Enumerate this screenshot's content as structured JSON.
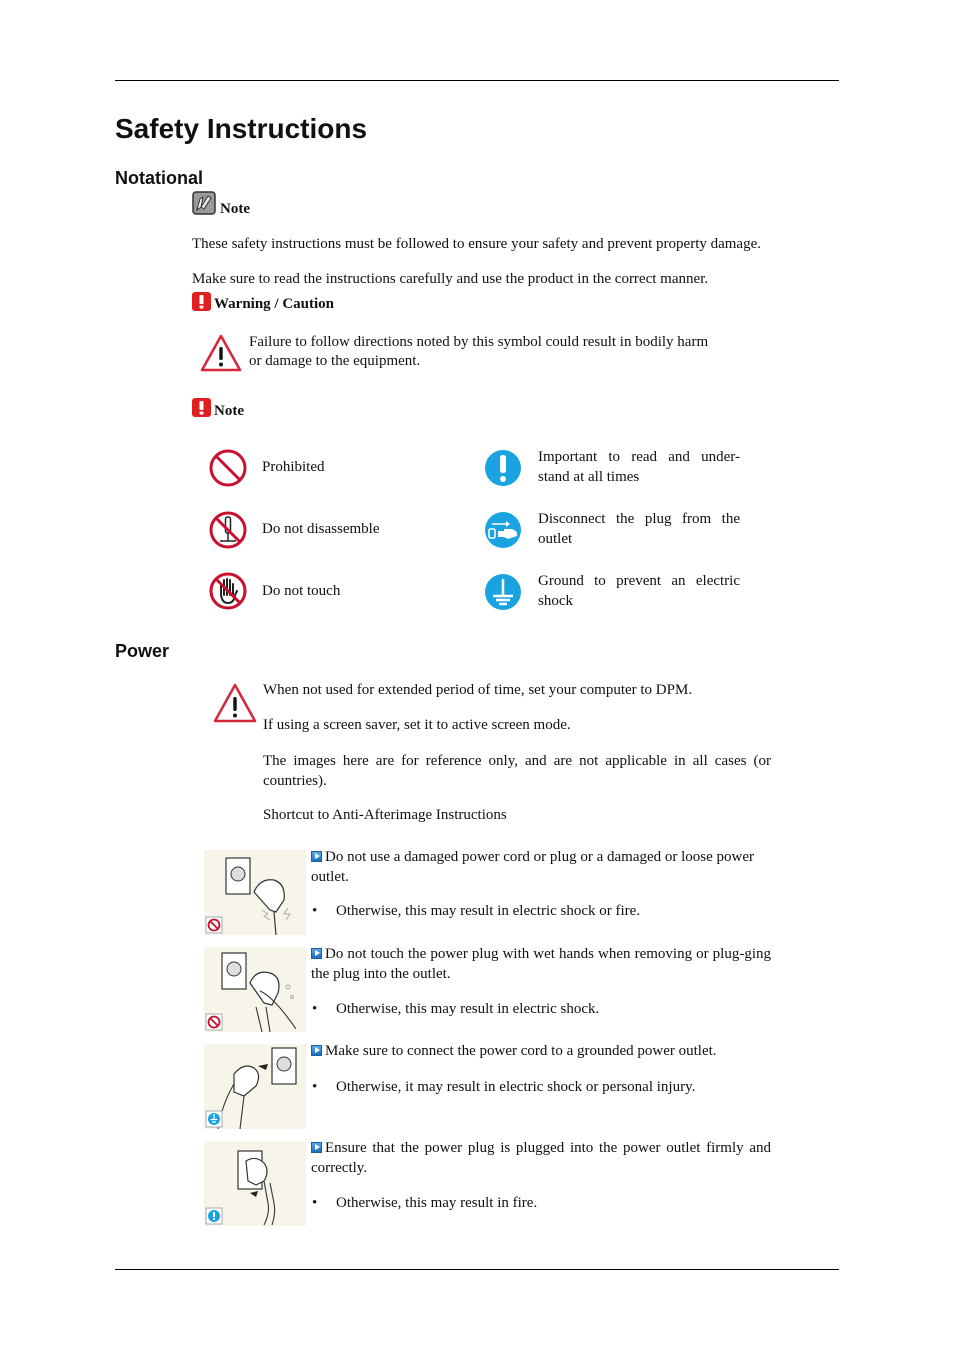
{
  "page_title": "Safety Instructions",
  "sections": {
    "notational": {
      "heading": "Notational",
      "note_label": "Note",
      "paragraphs": [
        "These safety instructions must be followed to ensure your safety and prevent property damage.",
        "Make sure to read the instructions carefully and use the product in the correct manner."
      ],
      "warning_label": "Warning / Caution",
      "warning_text_1": "Failure to follow directions noted by this symbol could result in bodily harm",
      "warning_text_2": "or damage to the equipment.",
      "note2_label": "Note",
      "symbols": [
        {
          "icon": "prohibited-icon",
          "label": "Prohibited"
        },
        {
          "icon": "do-not-disassemble-icon",
          "label": "Do not disassemble"
        },
        {
          "icon": "do-not-touch-icon",
          "label": "Do not touch"
        },
        {
          "icon": "important-icon",
          "label_1": "Important to read and under-",
          "label_2": "stand at all times"
        },
        {
          "icon": "disconnect-plug-icon",
          "label_1": "Disconnect the plug from the",
          "label_2": "outlet"
        },
        {
          "icon": "ground-icon",
          "label_1": "Ground to prevent an electric",
          "label_2": "shock"
        }
      ]
    },
    "power": {
      "heading": "Power",
      "intro": [
        "When not used for extended period of time, set your computer to DPM.",
        "If using a screen saver, set it to active screen mode.",
        "The images here are for reference only, and are not applicable in all cases (or countries).",
        "Shortcut to Anti-Afterimage Instructions"
      ],
      "items": [
        {
          "badge": "prohibited",
          "title": "Do not use a damaged power cord or plug or a damaged or loose power outlet.",
          "bullet": "Otherwise, this may result in electric shock or fire."
        },
        {
          "badge": "prohibited",
          "title": "Do not touch the power plug with wet hands when removing or plug-ging the plug into the outlet.",
          "bullet": "Otherwise, this may result in electric shock."
        },
        {
          "badge": "ground",
          "title": "Make sure to connect the power cord to a grounded power outlet.",
          "bullet": "Otherwise, it may result in electric shock or personal injury."
        },
        {
          "badge": "important",
          "title": "Ensure that the power plug is plugged into the power outlet firmly and correctly.",
          "bullet": "Otherwise, this may result in fire."
        }
      ]
    }
  },
  "colors": {
    "prohibited_red": "#c8102e",
    "info_blue": "#1aa3e0",
    "note_red": "#e02020",
    "thumb_bg": "#f7f5ea"
  }
}
